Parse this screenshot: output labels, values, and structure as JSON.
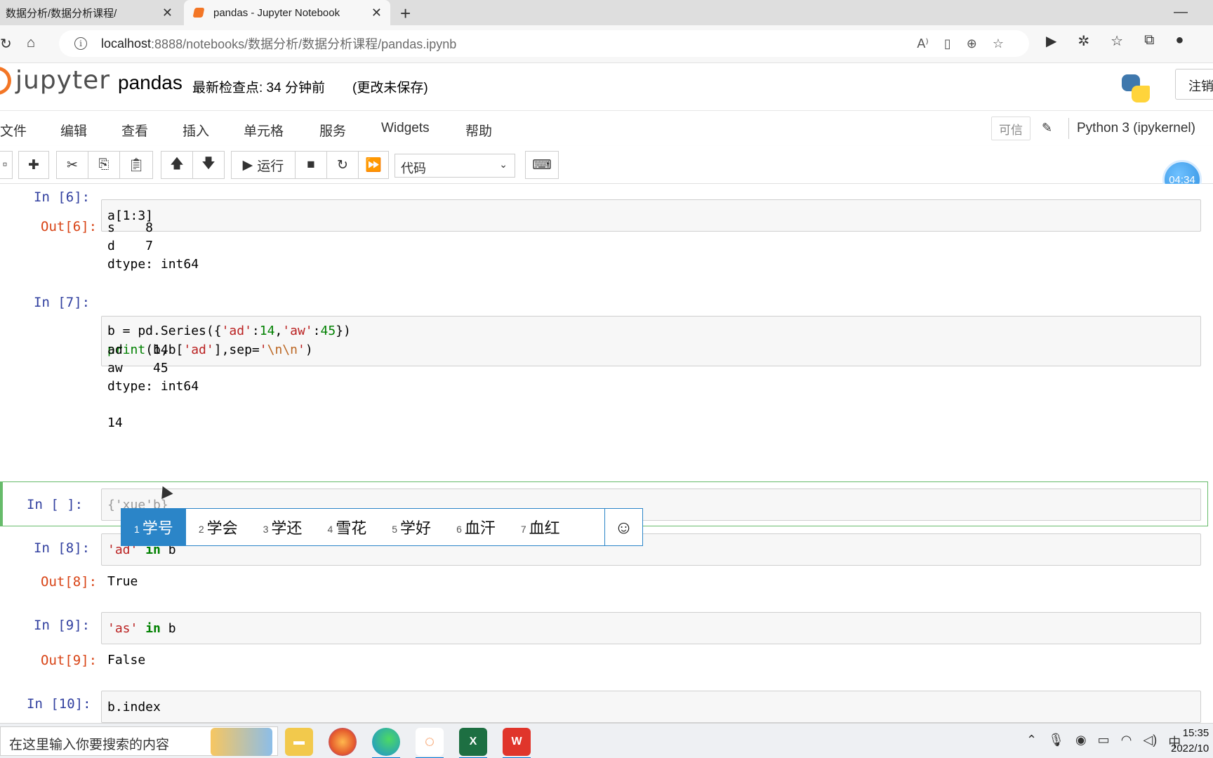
{
  "browser": {
    "tabs": [
      {
        "label": "数据分析/数据分析课程/",
        "active": false
      },
      {
        "label": "pandas - Jupyter Notebook",
        "active": true
      }
    ],
    "url_host": "localhost",
    "url_path": ":8888/notebooks/数据分析/数据分析课程/pandas.ipynb"
  },
  "header": {
    "logo_text": "jupyter",
    "notebook_name": "pandas",
    "checkpoint": "最新检查点: 34 分钟前",
    "unsaved": "(更改未保存)",
    "logout": "注销"
  },
  "menu": {
    "items": [
      "文件",
      "编辑",
      "查看",
      "插入",
      "单元格",
      "服务",
      "Widgets",
      "帮助"
    ],
    "trusted": "可信",
    "kernel": "Python 3 (ipykernel)"
  },
  "toolbar": {
    "run_label": "运行",
    "cell_type": "代码"
  },
  "timer": "04:34",
  "cells": {
    "c6": {
      "in_prompt": "In  [6]:",
      "code": "a[1:3]",
      "out_prompt": "Out[6]:",
      "output": [
        "s    8",
        "d    7",
        "dtype: int64"
      ]
    },
    "c7": {
      "in_prompt": "In  [7]:",
      "code_l1_a": "b = pd.Series({",
      "code_l1_s1": "'ad'",
      "code_l1_c": ":",
      "code_l1_n1": "14",
      "code_l1_comma": ",",
      "code_l1_s2": "'aw'",
      "code_l1_c2": ":",
      "code_l1_n2": "45",
      "code_l1_end": "})",
      "code_l2_fn": "print",
      "code_l2_a": "(b,b[",
      "code_l2_s": "'ad'",
      "code_l2_b": "],sep=",
      "code_l2_q1": "'",
      "code_l2_e": "\\n\\n",
      "code_l2_q2": "'",
      "code_l2_end": ")",
      "output": [
        "ad    14",
        "aw    45",
        "dtype: int64",
        "",
        "14"
      ]
    },
    "cedit": {
      "in_prompt": "In  [ ]:",
      "code": "{'xue'b}"
    },
    "c8": {
      "in_prompt": "In  [8]:",
      "code_s": "'ad'",
      "code_kw": "in",
      "code_v": "b",
      "out_prompt": "Out[8]:",
      "output": "True"
    },
    "c9": {
      "in_prompt": "In  [9]:",
      "code_s": "'as'",
      "code_kw": "in",
      "code_v": "b",
      "out_prompt": "Out[9]:",
      "output": "False"
    },
    "c10": {
      "in_prompt": "In  [10]:",
      "code": "b.index"
    }
  },
  "ime": {
    "candidates": [
      {
        "n": "1",
        "text": "学号"
      },
      {
        "n": "2",
        "text": "学会"
      },
      {
        "n": "3",
        "text": "学还"
      },
      {
        "n": "4",
        "text": "雪花"
      },
      {
        "n": "5",
        "text": "学好"
      },
      {
        "n": "6",
        "text": "血汗"
      },
      {
        "n": "7",
        "text": "血红"
      }
    ],
    "emoji": "☺"
  },
  "taskbar": {
    "search_placeholder": "在这里输入你要搜索的内容",
    "ime_indicator": "中",
    "time": "15:35",
    "date": "2022/10"
  }
}
